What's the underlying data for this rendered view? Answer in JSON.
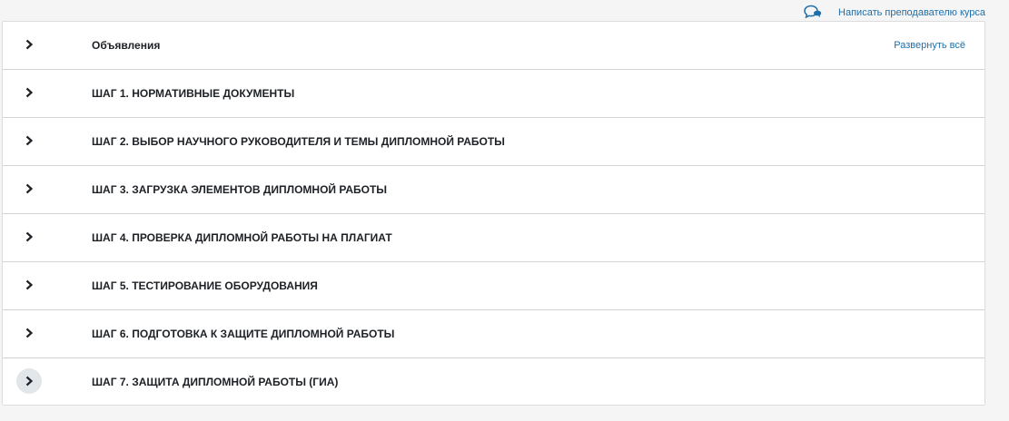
{
  "header": {
    "contact_teacher_label": "Написать преподавателю курса",
    "contact_icon": "chat-bubble-icon"
  },
  "course": {
    "expand_all_label": "Развернуть всё",
    "sections": [
      {
        "title": "Объявления",
        "expanded": false
      },
      {
        "title": "ШАГ 1. НОРМАТИВНЫЕ ДОКУМЕНТЫ",
        "expanded": false
      },
      {
        "title": "ШАГ 2. ВЫБОР НАУЧНОГО РУКОВОДИТЕЛЯ И ТЕМЫ ДИПЛОМНОЙ РАБОТЫ",
        "expanded": false
      },
      {
        "title": "ШАГ 3. ЗАГРУЗКА ЭЛЕМЕНТОВ ДИПЛОМНОЙ РАБОТЫ",
        "expanded": false
      },
      {
        "title": "ШАГ 4. ПРОВЕРКА ДИПЛОМНОЙ РАБОТЫ НА ПЛАГИАТ",
        "expanded": false
      },
      {
        "title": "ШАГ 5. ТЕСТИРОВАНИЕ ОБОРУДОВАНИЯ",
        "expanded": false
      },
      {
        "title": "ШАГ 6. ПОДГОТОВКА К ЗАЩИТЕ ДИПЛОМНОЙ РАБОТЫ",
        "expanded": false
      },
      {
        "title": "ШАГ 7. ЗАЩИТА ДИПЛОМНОЙ РАБОТЫ (ГИА)",
        "expanded": false
      }
    ]
  },
  "colors": {
    "link": "#1f6fa8",
    "title_text": "#1d2125",
    "hover_circle": "#e2e6ea"
  }
}
